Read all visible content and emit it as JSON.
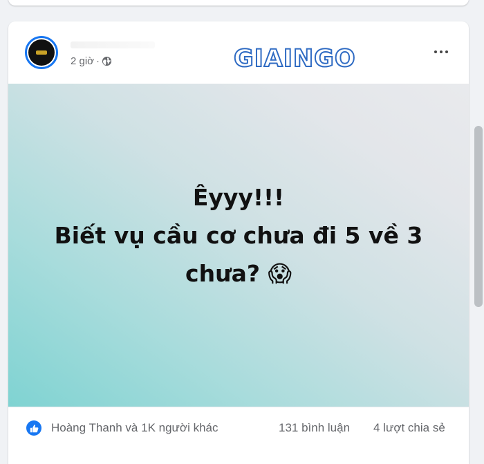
{
  "post": {
    "timestamp": "2 giờ",
    "separator": "·",
    "brand": "GIAINGO",
    "content_lines": [
      "Êyyy!!!",
      "Biết vụ cầu cơ chưa đi 5 về 3",
      "chưa?"
    ],
    "emoji": "😱"
  },
  "footer": {
    "reactions_text": "Hoàng Thanh và 1K người khác",
    "comments_text": "131 bình luận",
    "shares_text": "4 lượt chia sẻ"
  },
  "icons": {
    "globe": "globe-icon",
    "like": "like-icon",
    "more": "more-options-icon"
  },
  "colors": {
    "accent": "#1877f2",
    "brand": "#2f6bc3",
    "secondary_text": "#65676b"
  }
}
